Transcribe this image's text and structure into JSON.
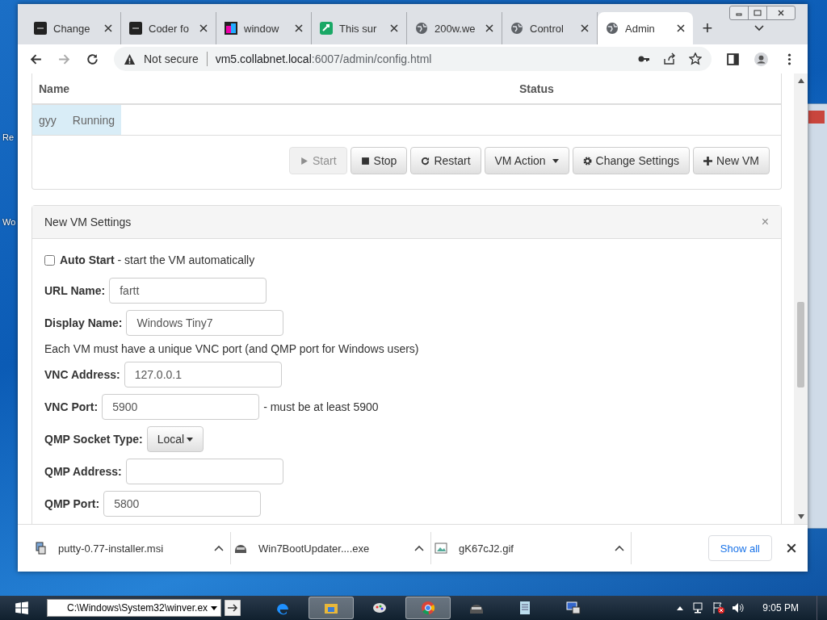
{
  "desktop": {
    "icons": [
      {
        "label": "Re"
      },
      {
        "label": "Wo"
      }
    ]
  },
  "browser": {
    "tabs": [
      {
        "title": "Change",
        "kind": "dark",
        "selected": false
      },
      {
        "title": "Coder fo",
        "kind": "dark",
        "selected": false
      },
      {
        "title": "window",
        "kind": "color",
        "selected": false
      },
      {
        "title": "This sur",
        "kind": "green",
        "selected": false
      },
      {
        "title": "200w.we",
        "kind": "globe",
        "selected": false
      },
      {
        "title": "Control",
        "kind": "globe",
        "selected": false
      },
      {
        "title": "Admin",
        "kind": "globe",
        "selected": true
      }
    ],
    "new_tab": "+",
    "address": {
      "security": "Not secure",
      "host": "vm5.collabnet.local",
      "path": ":6007/admin/config.html"
    }
  },
  "vm_table": {
    "columns": [
      "Name",
      "Status"
    ],
    "rows": [
      {
        "name": "gyy",
        "status": "Running",
        "selected": true
      }
    ]
  },
  "vm_buttons": [
    {
      "label": "Start",
      "kind": "play",
      "disabled": true
    },
    {
      "label": "Stop",
      "kind": "stop",
      "disabled": false
    },
    {
      "label": "Restart",
      "kind": "restart",
      "disabled": false
    },
    {
      "label": "VM Action",
      "kind": "dropdown",
      "disabled": false
    },
    {
      "label": "Change Settings",
      "kind": "gear",
      "disabled": false
    },
    {
      "label": "New VM",
      "kind": "plus",
      "disabled": false
    }
  ],
  "settings_panel": {
    "title": "New VM Settings",
    "close": "×",
    "auto_start": {
      "checked": false,
      "label": "Auto Start",
      "description": " - start the VM automatically"
    },
    "fields": [
      {
        "kind": "text",
        "label": "URL Name:",
        "value": "fartt"
      },
      {
        "kind": "text",
        "label": "Display Name:",
        "value": "Windows Tiny7"
      },
      {
        "kind": "note",
        "text": "Each VM must have a unique VNC port (and QMP port for Windows users)"
      },
      {
        "kind": "text",
        "label": "VNC Address:",
        "value": "127.0.0.1"
      },
      {
        "kind": "text",
        "label": "VNC Port:",
        "value": "5900",
        "hint": "- must be at least 5900"
      },
      {
        "kind": "dropdown",
        "label": "QMP Socket Type:",
        "value": "Local"
      },
      {
        "kind": "text",
        "label": "QMP Address:"
      },
      {
        "kind": "text",
        "label": "QMP Port:",
        "value": "5800"
      }
    ]
  },
  "downloads": {
    "items": [
      {
        "filename": "putty-0.77-installer.msi",
        "kind": "installer"
      },
      {
        "filename": "Win7BootUpdater....exe",
        "kind": "helmet"
      },
      {
        "filename": "gK67cJ2.gif",
        "kind": "image"
      }
    ],
    "show_all": "Show all"
  },
  "taskbar": {
    "run_box": "C:\\Windows\\System32\\winver.ex",
    "apps": [
      {
        "kind": "edge",
        "selected": false
      },
      {
        "kind": "folder",
        "selected": true
      },
      {
        "kind": "paint",
        "selected": false
      },
      {
        "kind": "chrome",
        "selected": true
      },
      {
        "kind": "helmet",
        "selected": false
      },
      {
        "kind": "notepad",
        "selected": false
      },
      {
        "kind": "monitor",
        "selected": false
      }
    ],
    "time": "9:05 PM"
  }
}
